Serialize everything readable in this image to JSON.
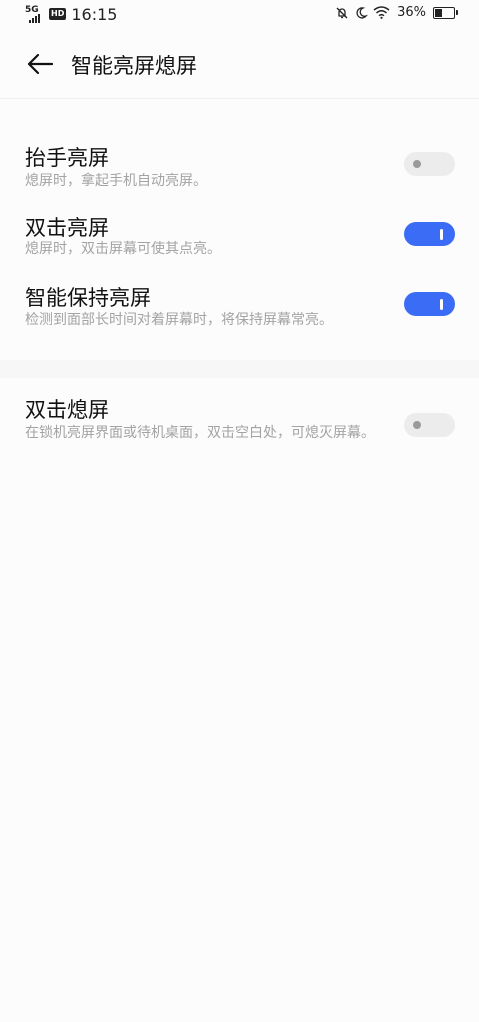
{
  "status_bar": {
    "network": "5G",
    "hd": "HD",
    "time": "16:15",
    "battery_percent": "36%",
    "battery_level": 0.36,
    "icons": [
      "mute-icon",
      "do-not-disturb-moon-icon",
      "wifi-icon",
      "battery-icon"
    ]
  },
  "header": {
    "back_icon": "back-arrow-icon",
    "title": "智能亮屏熄屏"
  },
  "settings": [
    {
      "label": "抬手亮屏",
      "description": "熄屏时，拿起手机自动亮屏。",
      "enabled": false
    },
    {
      "label": "双击亮屏",
      "description": "熄屏时，双击屏幕可使其点亮。",
      "enabled": true
    },
    {
      "label": "智能保持亮屏",
      "description": "检测到面部长时间对着屏幕时，将保持屏幕常亮。",
      "enabled": true
    },
    {
      "label": "双击熄屏",
      "description": "在锁机亮屏界面或待机桌面，双击空白处，可熄灭屏幕。",
      "enabled": false
    }
  ],
  "colors": {
    "toggle_on": "#3b6cf5",
    "toggle_off": "#ececec",
    "description_text": "#a3a3a3"
  }
}
